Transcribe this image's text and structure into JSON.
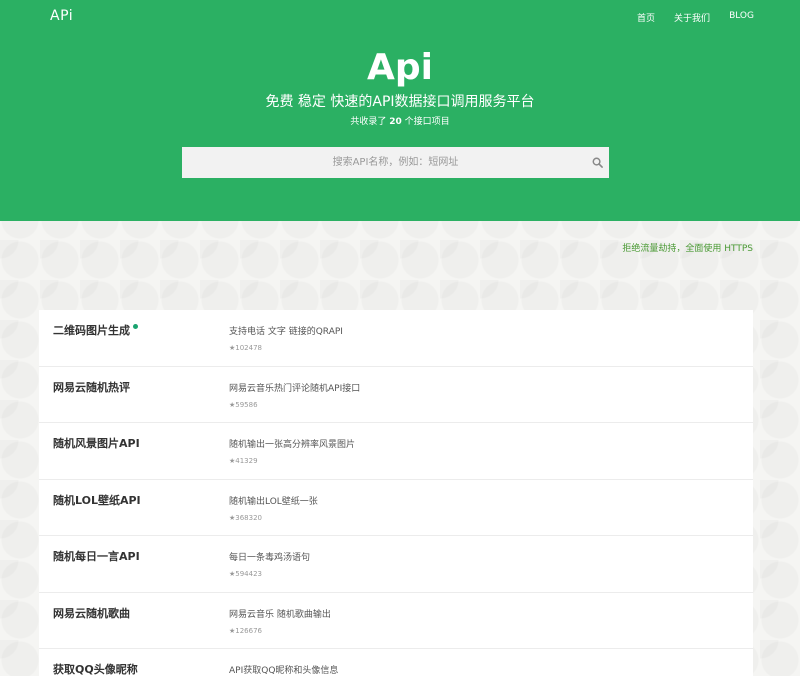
{
  "header": {
    "brand": "APi",
    "nav": [
      "首页",
      "关于我们",
      "BLOG"
    ]
  },
  "hero": {
    "title": "Api",
    "subtitle": "免费 稳定 快速的API数据接口调用服务平台",
    "count_prefix": "共收录了",
    "count": "20",
    "count_suffix": "个接口项目"
  },
  "search": {
    "placeholder": "搜索API名称，例如：短网址",
    "icon": "search-icon"
  },
  "https_note": "拒绝流量劫持，全面使用 HTTPS",
  "colors": {
    "hero_bg": "#2bb063",
    "accent_dot": "#1aa36f",
    "note_green": "#4a9a34"
  },
  "apis": [
    {
      "name": "二维码图片生成",
      "desc": "支持电话 文字 链接的QRAPI",
      "stars": "★102478",
      "hot": true
    },
    {
      "name": "网易云随机热评",
      "desc": "网易云音乐热门评论随机API接口",
      "stars": "★59586",
      "hot": false
    },
    {
      "name": "随机风景图片API",
      "desc": "随机输出一张高分辨率风景图片",
      "stars": "★41329",
      "hot": false
    },
    {
      "name": "随机LOL壁纸API",
      "desc": "随机输出LOL壁纸一张",
      "stars": "★368320",
      "hot": false
    },
    {
      "name": "随机每日一言API",
      "desc": "每日一条毒鸡汤语句",
      "stars": "★594423",
      "hot": false
    },
    {
      "name": "网易云随机歌曲",
      "desc": "网易云音乐 随机歌曲输出",
      "stars": "★126676",
      "hot": false
    },
    {
      "name": "获取QQ头像昵称",
      "desc": "API获取QQ昵称和头像信息",
      "stars": "",
      "hot": false
    }
  ]
}
